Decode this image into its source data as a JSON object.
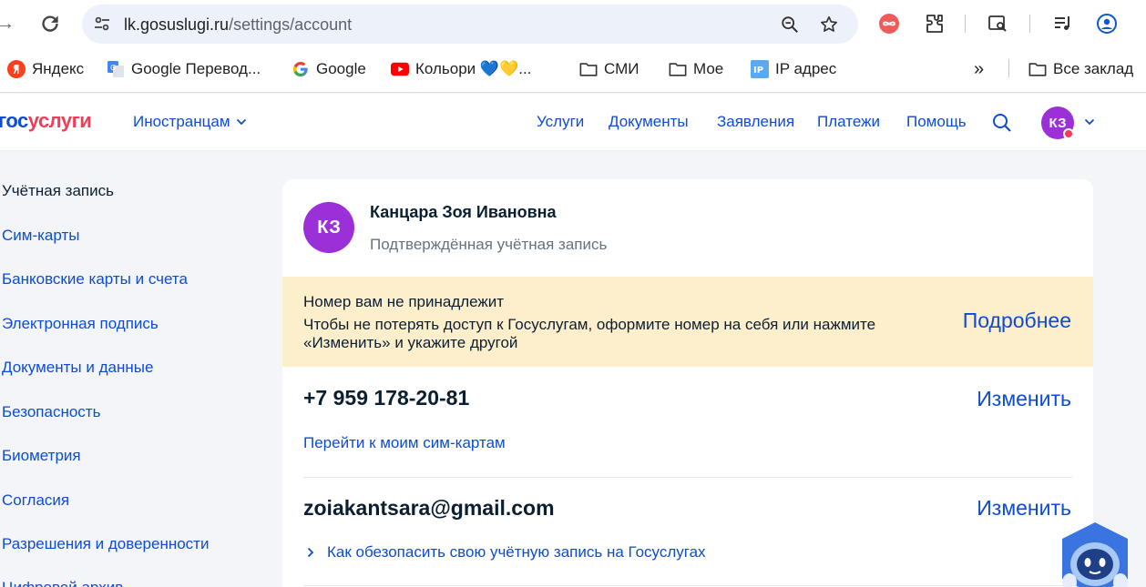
{
  "browser": {
    "url_host": "lk.gosuslugi.ru",
    "url_path": "/settings/account",
    "bookmarks": [
      {
        "label": "Яндекс",
        "icon": "yandex-icon"
      },
      {
        "label": "Google Перевод...",
        "icon": "google-translate-icon"
      },
      {
        "label": "Google",
        "icon": "google-icon"
      },
      {
        "label": "Кольори 💙💛...",
        "icon": "youtube-icon"
      },
      {
        "label": "СМИ",
        "icon": "folder-icon"
      },
      {
        "label": "Мое",
        "icon": "folder-icon"
      },
      {
        "label": "IP адрес",
        "icon": "ip-icon"
      },
      {
        "label": "Все заклад",
        "icon": "folder-icon"
      }
    ],
    "more_bookmarks": "»"
  },
  "header": {
    "logo_part1": "гос",
    "logo_part2": "услуги",
    "foreign": "Иностранцам",
    "nav": [
      "Услуги",
      "Документы",
      "Заявления",
      "Платежи",
      "Помощь"
    ],
    "user_initials": "КЗ"
  },
  "sidebar": {
    "items": [
      {
        "label": "Учётная запись",
        "active": true
      },
      {
        "label": "Сим-карты"
      },
      {
        "label": "Банковские карты и счета"
      },
      {
        "label": "Электронная подпись"
      },
      {
        "label": "Документы и данные"
      },
      {
        "label": "Безопасность"
      },
      {
        "label": "Биометрия"
      },
      {
        "label": "Согласия"
      },
      {
        "label": "Разрешения и доверенности"
      },
      {
        "label": "Цифровой архив"
      }
    ]
  },
  "account": {
    "initials": "КЗ",
    "name": "Канцара Зоя Ивановна",
    "status": "Подтверждённая учётная запись",
    "warning": {
      "title": "Номер вам не принадлежит",
      "text": "Чтобы не потерять доступ к Госуслугам, оформите номер на себя или нажмите «Изменить» и укажите другой",
      "link": "Подробнее"
    },
    "phone": "+7 959 178-20-81",
    "phone_change": "Изменить",
    "sim_link": "Перейти к моим сим-картам",
    "email": "zoiakantsara@gmail.com",
    "email_change": "Изменить",
    "secure_link": "Как обезопасить свою учётную запись на Госуслугах"
  },
  "colors": {
    "brand_blue": "#0d4cd3",
    "brand_red": "#ee3f58",
    "avatar_purple": "#9b30d9",
    "warning_bg": "#fdefcb"
  }
}
